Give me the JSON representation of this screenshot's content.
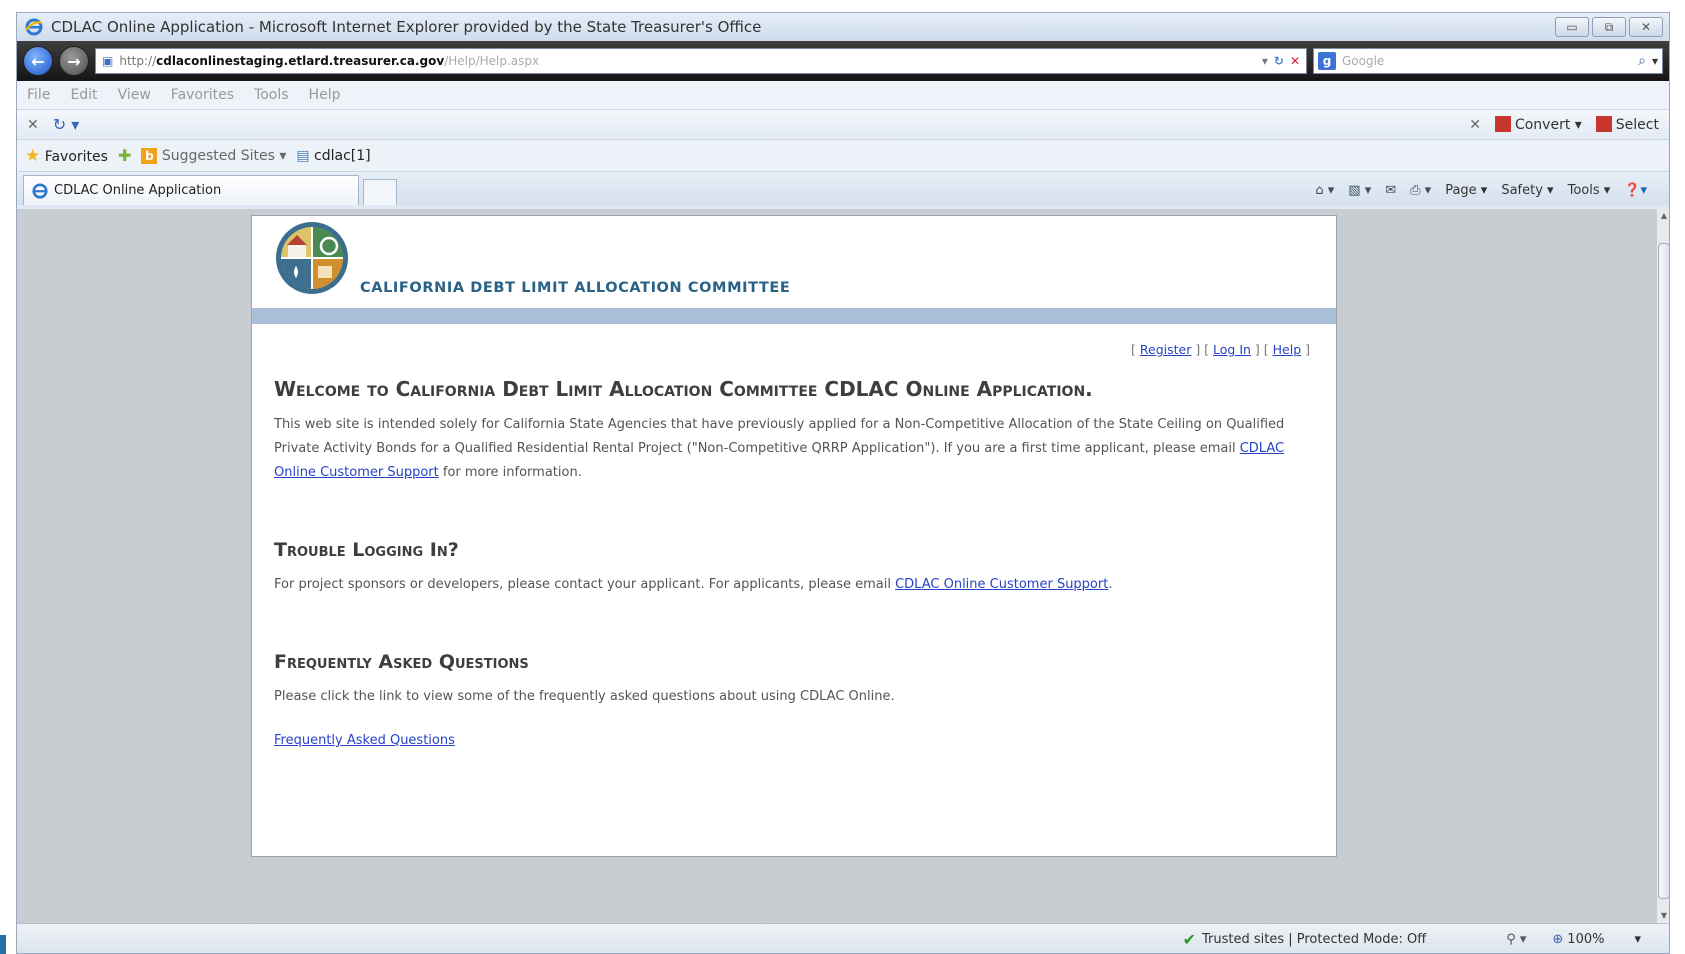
{
  "window": {
    "title": "CDLAC Online Application - Microsoft Internet Explorer provided by the State Treasurer's Office",
    "controls": [
      "▭",
      "⧉",
      "✕"
    ]
  },
  "address": {
    "scheme": "http://",
    "host": "cdlaconlinestaging.etlard.treasurer.ca.gov",
    "path": "/Help/Help.aspx"
  },
  "search": {
    "placeholder": "Google"
  },
  "menu": [
    "File",
    "Edit",
    "View",
    "Favorites",
    "Tools",
    "Help"
  ],
  "command_bar": {
    "convert_label": "Convert",
    "select_label": "Select"
  },
  "favorites_bar": {
    "favorites_label": "Favorites",
    "suggested_label": "Suggested Sites ▾",
    "link_label": "cdlac[1]"
  },
  "tab": {
    "label": "CDLAC Online Application"
  },
  "tab_tools": {
    "page_label": "Page ▾",
    "safety_label": "Safety ▾",
    "tools_label": "Tools ▾"
  },
  "site": {
    "org_name": "CALIFORNIA DEBT LIMIT ALLOCATION COMMITTEE",
    "links": {
      "register": "Register",
      "login": "Log In",
      "help": "Help"
    },
    "welcome_title": "Welcome to California Debt Limit Allocation Committee CDLAC Online Application.",
    "welcome_text": "This web site is intended solely for California State Agencies that have previously applied for a Non-Competitive Allocation of the State Ceiling on Qualified Private Activity Bonds for a Qualified Residential Rental Project (\"Non-Competitive QRRP Application\"). If you are a first time applicant, please email",
    "welcome_link": "CDLAC Online Customer Support",
    "welcome_tail": " for more information.",
    "trouble_title": "Trouble Logging In?",
    "trouble_text": "For project sponsors or developers, please contact your applicant.  For applicants, please email ",
    "trouble_link": "CDLAC Online Customer Support",
    "trouble_tail": ".",
    "faq_title": "Frequently Asked Questions",
    "faq_text": "Please click the link to view some of the frequently asked questions about using CDLAC Online.",
    "faq_link": "Frequently Asked Questions"
  },
  "status": {
    "zone": "Trusted sites | Protected Mode: Off",
    "zoom": "100%"
  }
}
